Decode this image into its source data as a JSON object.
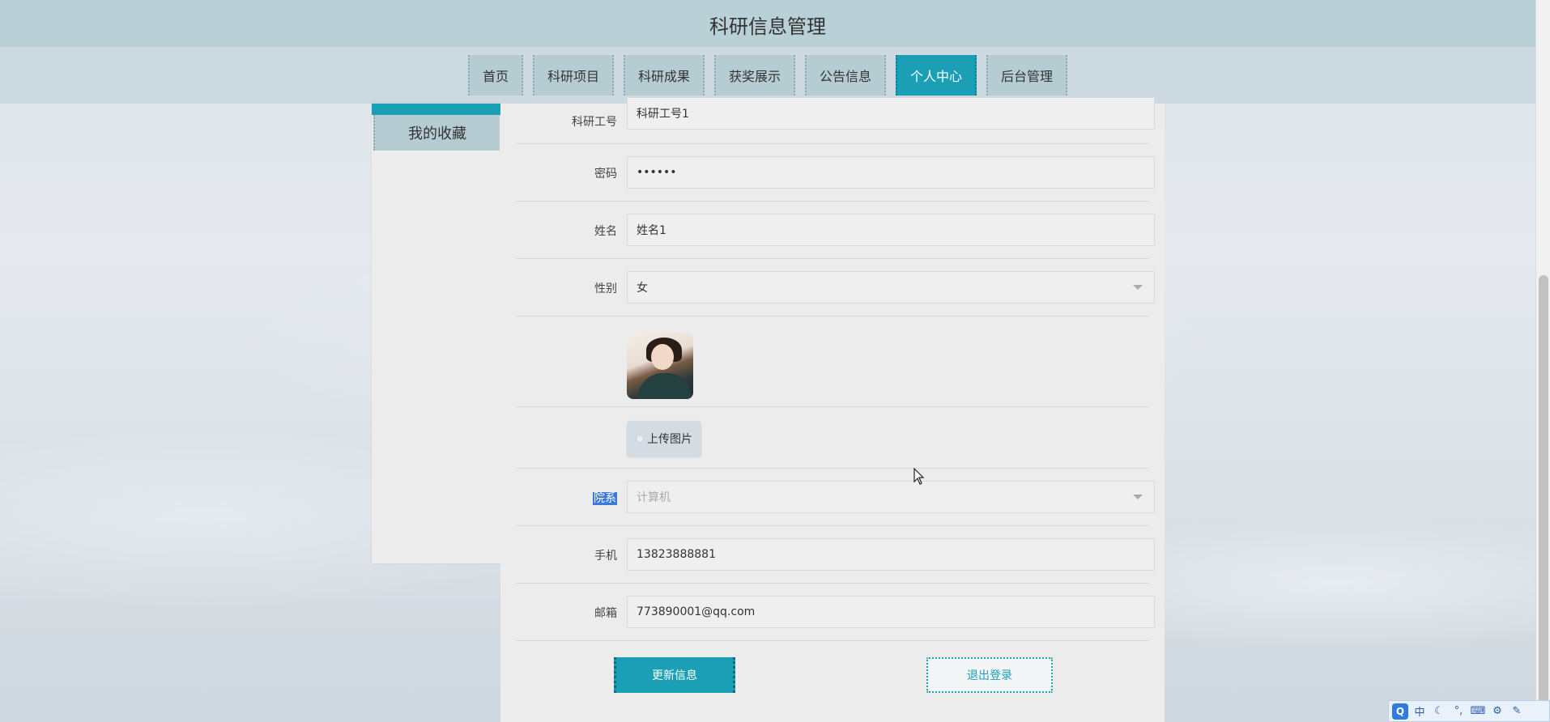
{
  "header": {
    "title": "科研信息管理"
  },
  "nav": {
    "items": [
      {
        "label": "首页",
        "active": false
      },
      {
        "label": "科研项目",
        "active": false
      },
      {
        "label": "科研成果",
        "active": false
      },
      {
        "label": "获奖展示",
        "active": false
      },
      {
        "label": "公告信息",
        "active": false
      },
      {
        "label": "个人中心",
        "active": true
      },
      {
        "label": "后台管理",
        "active": false
      }
    ]
  },
  "sidebar": {
    "items": [
      {
        "label": "我的收藏"
      }
    ]
  },
  "form": {
    "staff_id": {
      "label": "科研工号",
      "value": "科研工号1"
    },
    "password": {
      "label": "密码",
      "value": "••••••"
    },
    "name": {
      "label": "姓名",
      "value": "姓名1"
    },
    "gender": {
      "label": "性别",
      "value": "女"
    },
    "upload": {
      "label": "上传图片"
    },
    "department": {
      "label": "院系",
      "value": "计算机"
    },
    "phone": {
      "label": "手机",
      "value": "13823888881"
    },
    "email": {
      "label": "邮箱",
      "value": "773890001@qq.com"
    }
  },
  "actions": {
    "update_label": "更新信息",
    "logout_label": "退出登录"
  },
  "ime": {
    "logo": "Q",
    "mode": "中",
    "items": [
      "moon-icon",
      "punctuation-icon",
      "keyboard-icon",
      "settings-icon",
      "wrench-icon"
    ]
  },
  "colors": {
    "accent": "#1a9fb5",
    "header_bg": "#b8d0d6",
    "nav_bg": "#cdd9e1"
  }
}
